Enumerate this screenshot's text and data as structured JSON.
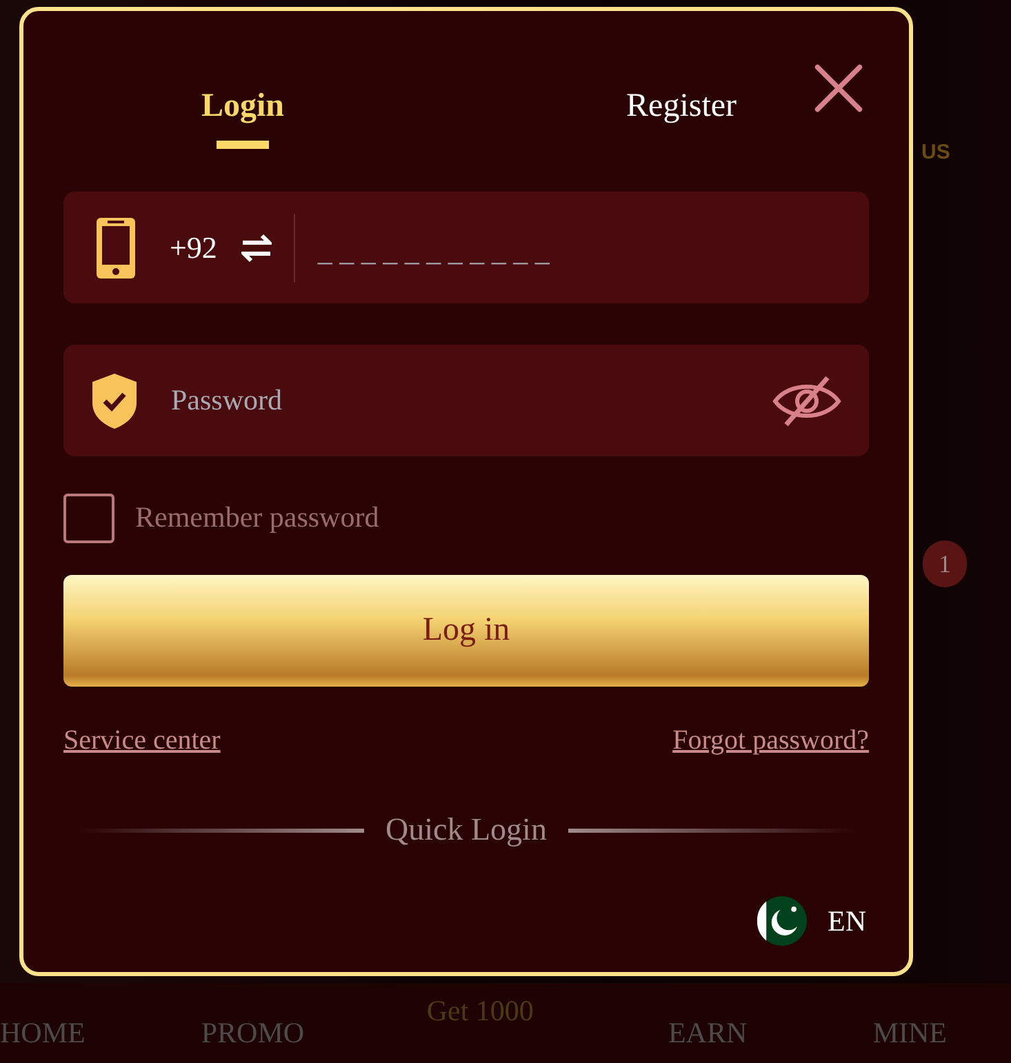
{
  "background": {
    "corner_label": "US",
    "badge": "1",
    "nav_items": [
      {
        "label": "HOME"
      },
      {
        "label": "PROMO"
      },
      {
        "label": "Get 1000"
      },
      {
        "label": "EARN"
      },
      {
        "label": "MINE"
      }
    ]
  },
  "dialog": {
    "tabs": [
      {
        "label": "Login",
        "selected": true
      },
      {
        "label": "Register",
        "selected": false
      }
    ],
    "phone_field": {
      "country_code": "+92",
      "placeholder": "_ _ _ _ _ _ _ _ _ _ _"
    },
    "password_field": {
      "placeholder": "Password",
      "visible": false
    },
    "remember_password": {
      "label": "Remember password",
      "checked": false
    },
    "login_button": "Log in",
    "links": [
      "Service center",
      "Forgot password?"
    ],
    "quick_login": "Quick Login",
    "language": "EN"
  }
}
